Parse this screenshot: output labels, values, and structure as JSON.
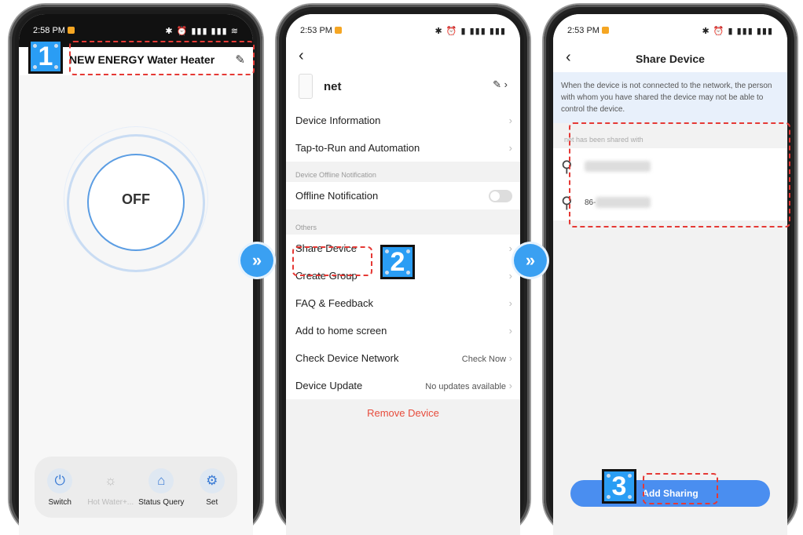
{
  "phone1": {
    "time": "2:58 PM",
    "status_icons": "✱ ⏰ ▮▮▮ ▮▮▮ ≋",
    "device_title": "NEW ENERGY Water Heater",
    "power_state": "OFF",
    "bottom_items": [
      {
        "label": "Switch",
        "icon": "power-icon",
        "glyph": "⏻"
      },
      {
        "label": "Hot Water+...",
        "icon": "sun-icon",
        "glyph": "☼"
      },
      {
        "label": "Status Query",
        "icon": "home-search-icon",
        "glyph": "⌂"
      },
      {
        "label": "Set",
        "icon": "gear-icon",
        "glyph": "⚙"
      }
    ]
  },
  "phone2": {
    "time": "2:53 PM",
    "status_icons": "✱ ⏰ ▮ ▮▮▮ ▮▮▮",
    "device_name": "net",
    "rows_a": [
      {
        "label": "Device Information"
      },
      {
        "label": "Tap-to-Run and Automation"
      }
    ],
    "section_offline": "Device Offline Notification",
    "offline_label": "Offline Notification",
    "section_others": "Others",
    "rows_b": [
      {
        "label": "Share Device",
        "value": ""
      },
      {
        "label": "Create Group",
        "value": ""
      },
      {
        "label": "FAQ & Feedback",
        "value": ""
      },
      {
        "label": "Add to home screen",
        "value": ""
      },
      {
        "label": "Check Device Network",
        "value": "Check Now"
      },
      {
        "label": "Device Update",
        "value": "No updates available"
      }
    ],
    "remove_label": "Remove Device"
  },
  "phone3": {
    "time": "2:53 PM",
    "status_icons": "✱ ⏰ ▮ ▮▮▮ ▮▮▮",
    "title": "Share Device",
    "notice": "When the device is not connected to the network, the person with whom you have shared the device may not be able to control the device.",
    "shared_with_label": "net has been shared with",
    "contacts": [
      {
        "name": ""
      },
      {
        "name": "86-"
      }
    ],
    "add_sharing_label": "Add Sharing"
  },
  "callouts": [
    "1",
    "2",
    "3"
  ],
  "arrows": [
    "»",
    "»"
  ],
  "colors": {
    "accent": "#3a8ef0",
    "callout_blue": "#2a9df4",
    "dash_red": "#e53935",
    "remove_red": "#e74c3c"
  }
}
